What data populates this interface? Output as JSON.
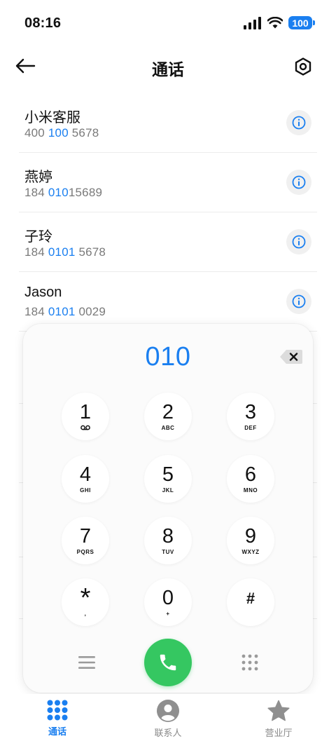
{
  "status_bar": {
    "time": "08:16",
    "battery": "100"
  },
  "header": {
    "title": "通话"
  },
  "contacts": [
    {
      "name": "小米客服",
      "number_pre": "400 ",
      "number_match": "100",
      "number_post": " 5678"
    },
    {
      "name": "燕婷",
      "number_pre": "184 ",
      "number_match": "010",
      "number_post": "15689"
    },
    {
      "name": "子玲",
      "number_pre": "184 ",
      "number_match": "0101",
      "number_post": " 5678"
    },
    {
      "name": "Jason",
      "number_pre": "184 ",
      "number_match": "0101",
      "number_post": " 0029"
    }
  ],
  "dialer": {
    "input": "010",
    "keys": [
      {
        "digit": "1",
        "sub": "voicemail-icon"
      },
      {
        "digit": "2",
        "sub": "ABC"
      },
      {
        "digit": "3",
        "sub": "DEF"
      },
      {
        "digit": "4",
        "sub": "GHI"
      },
      {
        "digit": "5",
        "sub": "JKL"
      },
      {
        "digit": "6",
        "sub": "MNO"
      },
      {
        "digit": "7",
        "sub": "PQRS"
      },
      {
        "digit": "8",
        "sub": "TUV"
      },
      {
        "digit": "9",
        "sub": "WXYZ"
      },
      {
        "digit": "*",
        "sub": ","
      },
      {
        "digit": "0",
        "sub": "+"
      },
      {
        "digit": "#",
        "sub": ""
      }
    ]
  },
  "bottom_nav": [
    {
      "label": "通话",
      "icon": "dialpad-grid-icon",
      "active": true
    },
    {
      "label": "联系人",
      "icon": "person-icon",
      "active": false
    },
    {
      "label": "营业厅",
      "icon": "star-icon",
      "active": false
    }
  ],
  "colors": {
    "accent": "#1a7ff0",
    "call_green": "#35c761"
  }
}
